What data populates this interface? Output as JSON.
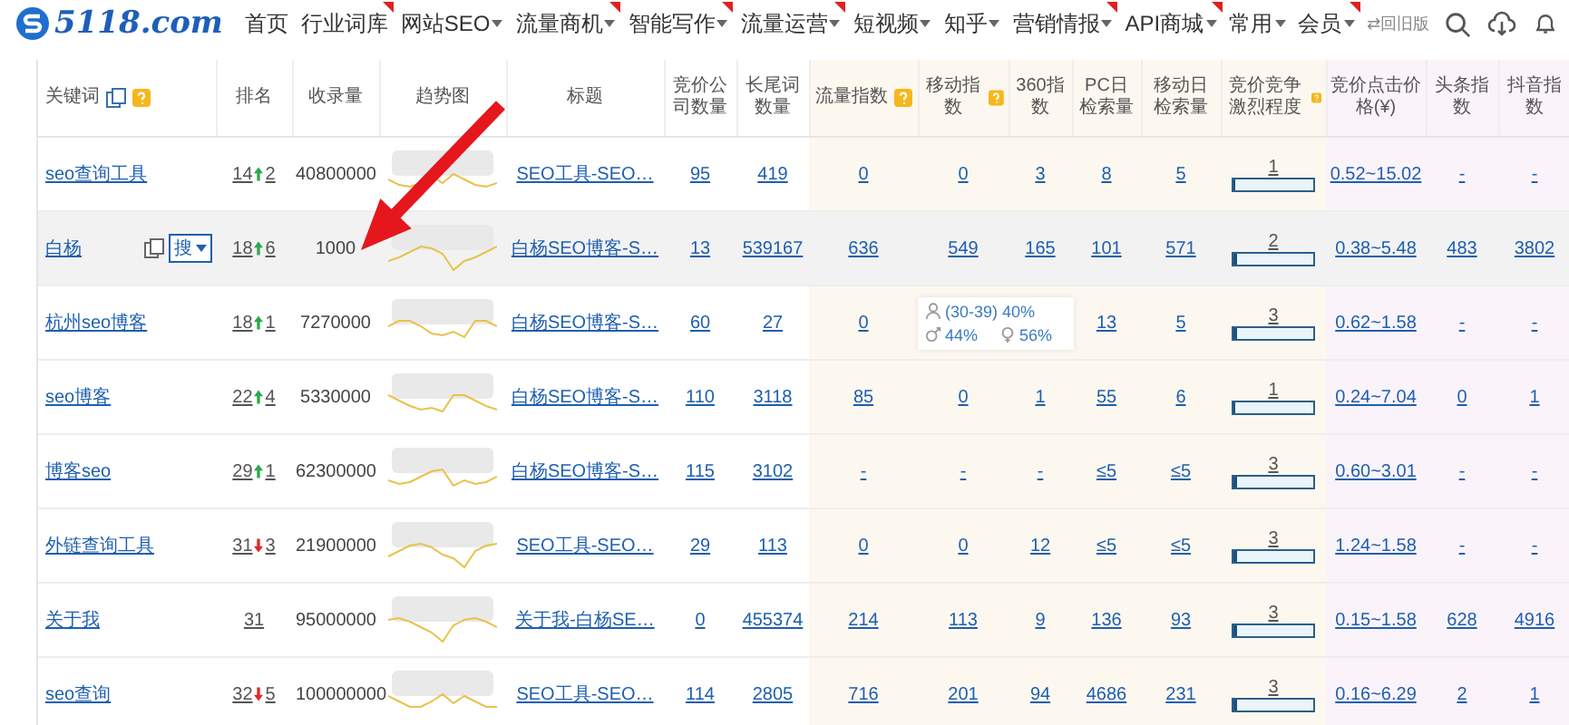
{
  "nav": {
    "logo": "5118.com",
    "items": [
      {
        "label": "首页",
        "dropdown": false,
        "hot": false
      },
      {
        "label": "行业词库",
        "dropdown": false,
        "hot": true
      },
      {
        "label": "网站SEO",
        "dropdown": true,
        "hot": false
      },
      {
        "label": "流量商机",
        "dropdown": true,
        "hot": true
      },
      {
        "label": "智能写作",
        "dropdown": true,
        "hot": true
      },
      {
        "label": "流量运营",
        "dropdown": true,
        "hot": true
      },
      {
        "label": "短视频",
        "dropdown": true,
        "hot": false
      },
      {
        "label": "知乎",
        "dropdown": true,
        "hot": false
      },
      {
        "label": "营销情报",
        "dropdown": true,
        "hot": true
      },
      {
        "label": "API商城",
        "dropdown": true,
        "hot": true
      },
      {
        "label": "常用",
        "dropdown": true,
        "hot": false
      },
      {
        "label": "会员",
        "dropdown": true,
        "hot": true
      }
    ],
    "old_version": "⇄回旧版"
  },
  "table": {
    "columns": [
      {
        "label": "关键词",
        "help": true
      },
      {
        "label": "排名",
        "help": false
      },
      {
        "label": "收录量",
        "help": false
      },
      {
        "label": "趋势图",
        "help": false
      },
      {
        "label": "标题",
        "help": false
      },
      {
        "label": "竞价公司数量",
        "help": false
      },
      {
        "label": "长尾词数量",
        "help": false
      },
      {
        "label": "流量指数",
        "help": true
      },
      {
        "label": "移动指数",
        "help": true
      },
      {
        "label": "360指数",
        "help": false
      },
      {
        "label": "PC日检索量",
        "help": false
      },
      {
        "label": "移动日检索量",
        "help": false
      },
      {
        "label": "竞价竞争激烈程度",
        "help": true
      },
      {
        "label": "竞价点击价格(¥)",
        "help": false
      },
      {
        "label": "头条指数",
        "help": false
      },
      {
        "label": "抖音指数",
        "help": false
      }
    ],
    "rows": [
      {
        "hovered": false,
        "keyword": "seo查询工具",
        "rank": "14",
        "up": true,
        "change": "2",
        "indexed": "40800000",
        "title": "SEO工具-SEO…",
        "bid": "95",
        "longtail": "419",
        "traffic": "0",
        "mobile": "0",
        "i360": "3",
        "pc": "8",
        "mdaily": "5",
        "competition": "1",
        "level": 0.02,
        "price": "0.52~15.02",
        "toutiao": "-",
        "douyin": "-"
      },
      {
        "hovered": true,
        "keyword": "白杨",
        "search_label": "搜",
        "rank": "18",
        "up": true,
        "change": "6",
        "indexed": "1000",
        "title": "白杨SEO博客-S…",
        "bid": "13",
        "longtail": "539167",
        "traffic": "636",
        "mobile": "549",
        "i360": "165",
        "pc": "101",
        "mdaily": "571",
        "competition": "2",
        "level": 0.04,
        "price": "0.38~5.48",
        "toutiao": "483",
        "douyin": "3802"
      },
      {
        "hovered": false,
        "keyword": "杭州seo博客",
        "rank": "18",
        "up": true,
        "change": "1",
        "indexed": "7270000",
        "title": "白杨SEO博客-S…",
        "bid": "60",
        "longtail": "27",
        "traffic": "0",
        "pc": "13",
        "mdaily": "5",
        "competition": "3",
        "level": 0.05,
        "price": "0.62~1.58",
        "toutiao": "-",
        "douyin": "-",
        "tooltip": {
          "age": "(30-39) 40%",
          "male": "44%",
          "female": "56%"
        }
      },
      {
        "hovered": false,
        "keyword": "seo博客",
        "rank": "22",
        "up": true,
        "change": "4",
        "indexed": "5330000",
        "title": "白杨SEO博客-S…",
        "bid": "110",
        "longtail": "3118",
        "traffic": "85",
        "mobile": "0",
        "i360": "1",
        "pc": "55",
        "mdaily": "6",
        "competition": "1",
        "level": 0.02,
        "price": "0.24~7.04",
        "toutiao": "0",
        "douyin": "1"
      },
      {
        "hovered": false,
        "keyword": "博客seo",
        "rank": "29",
        "up": true,
        "change": "1",
        "indexed": "62300000",
        "title": "白杨SEO博客-S…",
        "bid": "115",
        "longtail": "3102",
        "traffic": "-",
        "mobile": "-",
        "i360": "-",
        "pc": "≤5",
        "mdaily": "≤5",
        "competition": "3",
        "level": 0.05,
        "price": "0.60~3.01",
        "toutiao": "-",
        "douyin": "-"
      },
      {
        "hovered": false,
        "keyword": "外链查询工具",
        "rank": "31",
        "up": false,
        "change": "3",
        "indexed": "21900000",
        "title": "SEO工具-SEO…",
        "bid": "29",
        "longtail": "113",
        "traffic": "0",
        "mobile": "0",
        "i360": "12",
        "pc": "≤5",
        "mdaily": "≤5",
        "competition": "3",
        "level": 0.05,
        "price": "1.24~1.58",
        "toutiao": "-",
        "douyin": "-"
      },
      {
        "hovered": false,
        "keyword": "关于我",
        "rank": "31",
        "indexed": "95000000",
        "title": "关于我-白杨SE…",
        "bid": "0",
        "longtail": "455374",
        "traffic": "214",
        "mobile": "113",
        "i360": "9",
        "pc": "136",
        "mdaily": "93",
        "competition": "3",
        "level": 0.05,
        "price": "0.15~1.58",
        "toutiao": "628",
        "douyin": "4916"
      },
      {
        "hovered": false,
        "keyword": "seo查询",
        "rank": "32",
        "up": false,
        "change": "5",
        "indexed": "100000000",
        "title": "SEO工具-SEO…",
        "bid": "114",
        "longtail": "2805",
        "traffic": "716",
        "mobile": "201",
        "i360": "94",
        "pc": "4686",
        "mdaily": "231",
        "competition": "3",
        "level": 0.05,
        "price": "0.16~6.29",
        "toutiao": "2",
        "douyin": "1"
      }
    ]
  }
}
